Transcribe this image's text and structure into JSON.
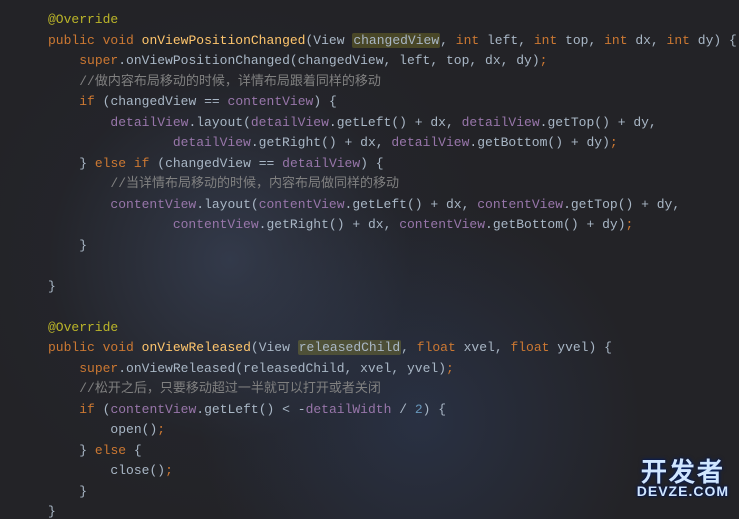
{
  "watermark": {
    "cn": "开发者",
    "en": "DEVZE.COM"
  },
  "annotation": {
    "override": "@Override"
  },
  "keywords": {
    "public": "public",
    "void": "void",
    "int": "int",
    "float": "float",
    "super": "super",
    "if": "if",
    "else": "else",
    "elseif": "else if"
  },
  "methods": {
    "onViewPositionChanged": "onViewPositionChanged",
    "onViewReleased": "onViewReleased",
    "layout": "layout",
    "getLeft": "getLeft",
    "getTop": "getTop",
    "getRight": "getRight",
    "getBottom": "getBottom",
    "open": "open",
    "close": "close"
  },
  "params": {
    "changedView": "changedView",
    "left": "left",
    "top": "top",
    "dx": "dx",
    "dy": "dy",
    "releasedChild": "releasedChild",
    "xvel": "xvel",
    "yvel": "yvel"
  },
  "fields": {
    "contentView": "contentView",
    "detailView": "detailView",
    "detailWidth": "detailWidth"
  },
  "types": {
    "View": "View"
  },
  "numbers": {
    "two": "2"
  },
  "comments": {
    "c1": "//做内容布局移动的时候，详情布局跟着同样的移动",
    "c2": "//当详情布局移动的时候，内容布局做同样的移动",
    "c3": "//松开之后，只要移动超过一半就可以打开或者关闭"
  },
  "sym": {
    "lparen": "(",
    "rparen": ")",
    "lbrace": "{",
    "rbrace": "}",
    "comma": ",",
    "semi": ";",
    "eqeq": "==",
    "plus": "+",
    "dot": ".",
    "lt": "<",
    "neg": "-",
    "div": "/"
  }
}
